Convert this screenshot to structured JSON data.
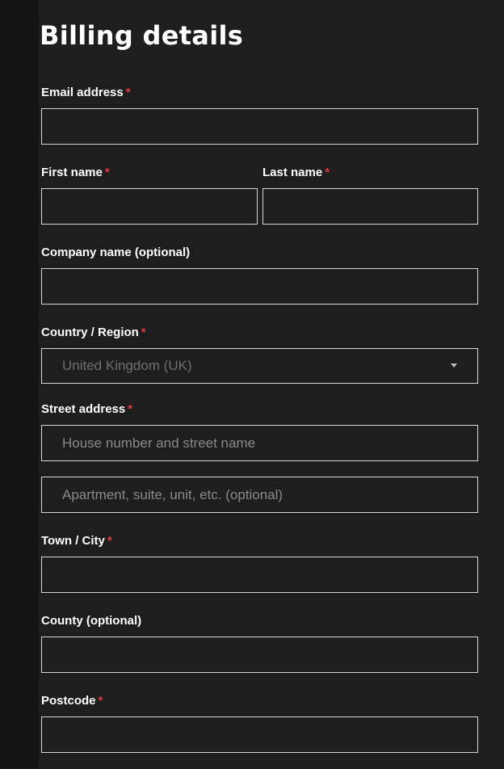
{
  "page": {
    "title": "Billing details"
  },
  "form": {
    "email": {
      "label": "Email address",
      "required_mark": "*",
      "value": "",
      "placeholder": ""
    },
    "first_name": {
      "label": "First name",
      "required_mark": "*",
      "value": "",
      "placeholder": ""
    },
    "last_name": {
      "label": "Last name",
      "required_mark": "*",
      "value": "",
      "placeholder": ""
    },
    "company": {
      "label": "Company name (optional)",
      "value": "",
      "placeholder": ""
    },
    "country": {
      "label": "Country / Region",
      "required_mark": "*",
      "selected": "United Kingdom (UK)",
      "icon": "chevron-down-icon"
    },
    "street": {
      "label": "Street address",
      "required_mark": "*",
      "line1_placeholder": "House number and street name",
      "line2_placeholder": "Apartment, suite, unit, etc. (optional)"
    },
    "city": {
      "label": "Town / City",
      "required_mark": "*",
      "value": "",
      "placeholder": ""
    },
    "county": {
      "label": "County (optional)",
      "value": "",
      "placeholder": ""
    },
    "postcode": {
      "label": "Postcode",
      "required_mark": "*",
      "value": "",
      "placeholder": ""
    }
  },
  "colors": {
    "background": "#1e1e1e",
    "text": "#ffffff",
    "required": "#e0393e",
    "border": "#d9d9d9",
    "placeholder": "#8a8a8a"
  }
}
